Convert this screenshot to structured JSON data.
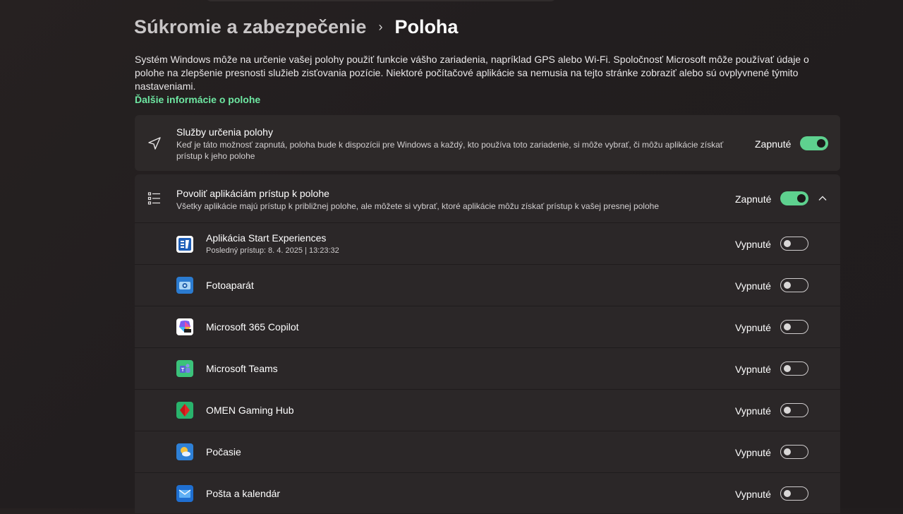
{
  "breadcrumb": {
    "parent": "Súkromie a zabezpečenie",
    "separator": "›",
    "current": "Poloha"
  },
  "intro": {
    "text": "Systém Windows môže na určenie vašej polohy použiť funkcie vášho zariadenia, napríklad GPS alebo Wi-Fi. Spoločnosť Microsoft môže používať údaje o polohe na zlepšenie presnosti služieb zisťovania pozície. Niektoré počítačové aplikácie sa nemusia na tejto stránke zobraziť alebo sú ovplyvnené týmito nastaveniami.",
    "link": "Ďalšie informácie o polohe"
  },
  "location_services": {
    "title": "Služby určenia polohy",
    "description": "Keď je táto možnosť zapnutá, poloha bude k dispozícii pre Windows a každý, kto používa toto zariadenie, si môže vybrať, či môžu aplikácie získať prístup k jeho polohe",
    "state": "Zapnuté",
    "on": true
  },
  "app_access": {
    "title": "Povoliť aplikáciám prístup k polohe",
    "description": "Všetky aplikácie majú prístup k približnej polohe, ale môžete si vybrať, ktoré aplikácie môžu získať prístup k vašej presnej polohe",
    "state": "Zapnuté",
    "on": true,
    "expanded": true
  },
  "apps": [
    {
      "name": "Aplikácia Start Experiences",
      "sub": "Posledný prístup: 8. 4. 2025  |  13:23:32",
      "state": "Vypnuté",
      "icon": "start-experiences-icon"
    },
    {
      "name": "Fotoaparát",
      "state": "Vypnuté",
      "icon": "camera-app-icon"
    },
    {
      "name": "Microsoft 365 Copilot",
      "state": "Vypnuté",
      "icon": "m365-copilot-icon"
    },
    {
      "name": "Microsoft Teams",
      "state": "Vypnuté",
      "icon": "teams-icon"
    },
    {
      "name": "OMEN Gaming Hub",
      "state": "Vypnuté",
      "icon": "omen-icon"
    },
    {
      "name": "Počasie",
      "state": "Vypnuté",
      "icon": "weather-icon"
    },
    {
      "name": "Pošta a kalendár",
      "state": "Vypnuté",
      "icon": "mail-calendar-icon"
    }
  ],
  "colors": {
    "accent": "#5ed18f",
    "link": "#6ee7a2",
    "card": "#2d2929",
    "background": "#231f20"
  }
}
